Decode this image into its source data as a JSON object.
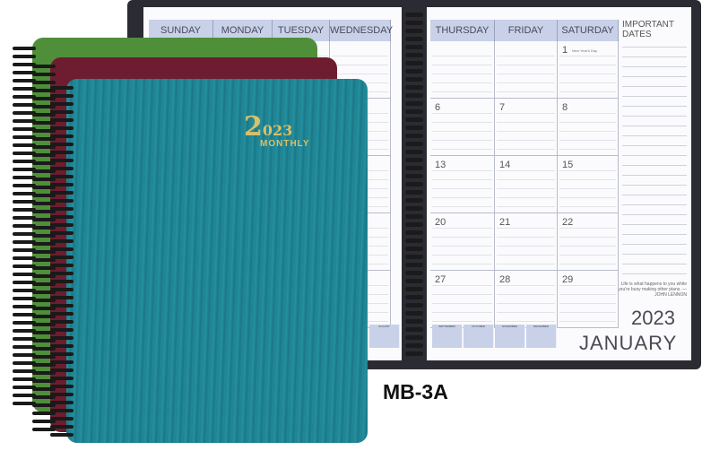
{
  "planner": {
    "left_days": [
      "SUNDAY",
      "MONDAY",
      "TUESDAY",
      "WEDNESDAY"
    ],
    "right_days": [
      "THURSDAY",
      "FRIDAY",
      "SATURDAY"
    ],
    "important_dates_title": "IMPORTANT DATES",
    "weeks": [
      [
        "",
        "",
        "1"
      ],
      [
        "6",
        "7",
        "8"
      ],
      [
        "13",
        "14",
        "15"
      ],
      [
        "20",
        "21",
        "22"
      ],
      [
        "27",
        "28",
        "29"
      ]
    ],
    "holiday_note": "New Year's Day",
    "quote": "Life is what happens to you while you're busy making other plans. —JOHN LENNON",
    "year": "2023",
    "month": "JANUARY",
    "mini_calendars_right": [
      "SEPTEMBER",
      "OCTOBER",
      "NOVEMBER",
      "DECEMBER"
    ],
    "mini_calendar_left": "AUGUST"
  },
  "cover": {
    "year_first": "2",
    "year_rest": "023",
    "subtitle": "MONTHLY",
    "colors": [
      "#4f8f3a",
      "#6d1d2f",
      "#1e8191"
    ]
  },
  "model_code": "MB-3A"
}
